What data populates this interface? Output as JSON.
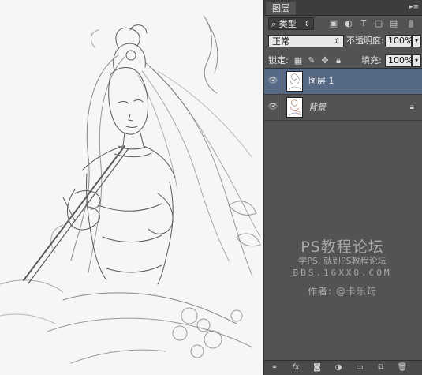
{
  "panel": {
    "tab_label": "图层",
    "menu_icon": "panel-menu-icon",
    "filter_kind_label": "类型",
    "filter_icons": [
      "image-filter-icon",
      "adjustment-filter-icon",
      "type-filter-icon",
      "shape-filter-icon",
      "smart-object-filter-icon"
    ],
    "blend_mode": "正常",
    "opacity_label": "不透明度:",
    "opacity_value": "100%",
    "lock_label": "锁定:",
    "lock_icons": [
      "lock-transparent-icon",
      "lock-image-icon",
      "lock-position-icon",
      "lock-all-icon"
    ],
    "fill_label": "填充:",
    "fill_value": "100%"
  },
  "layers": [
    {
      "name": "图层 1",
      "selected": true,
      "visible": true,
      "locked": false
    },
    {
      "name": "背景",
      "selected": false,
      "visible": true,
      "locked": true
    }
  ],
  "bottom_icons": [
    "link-layers-icon",
    "layer-style-fx-icon",
    "add-mask-icon",
    "new-adjustment-icon",
    "new-group-icon",
    "new-layer-icon",
    "delete-layer-icon"
  ],
  "watermark": {
    "title": "PS教程论坛",
    "subtitle": "学PS, 就到PS教程论坛",
    "url": "BBS.16XX8.COM",
    "author": "作者: @卡乐筠"
  }
}
